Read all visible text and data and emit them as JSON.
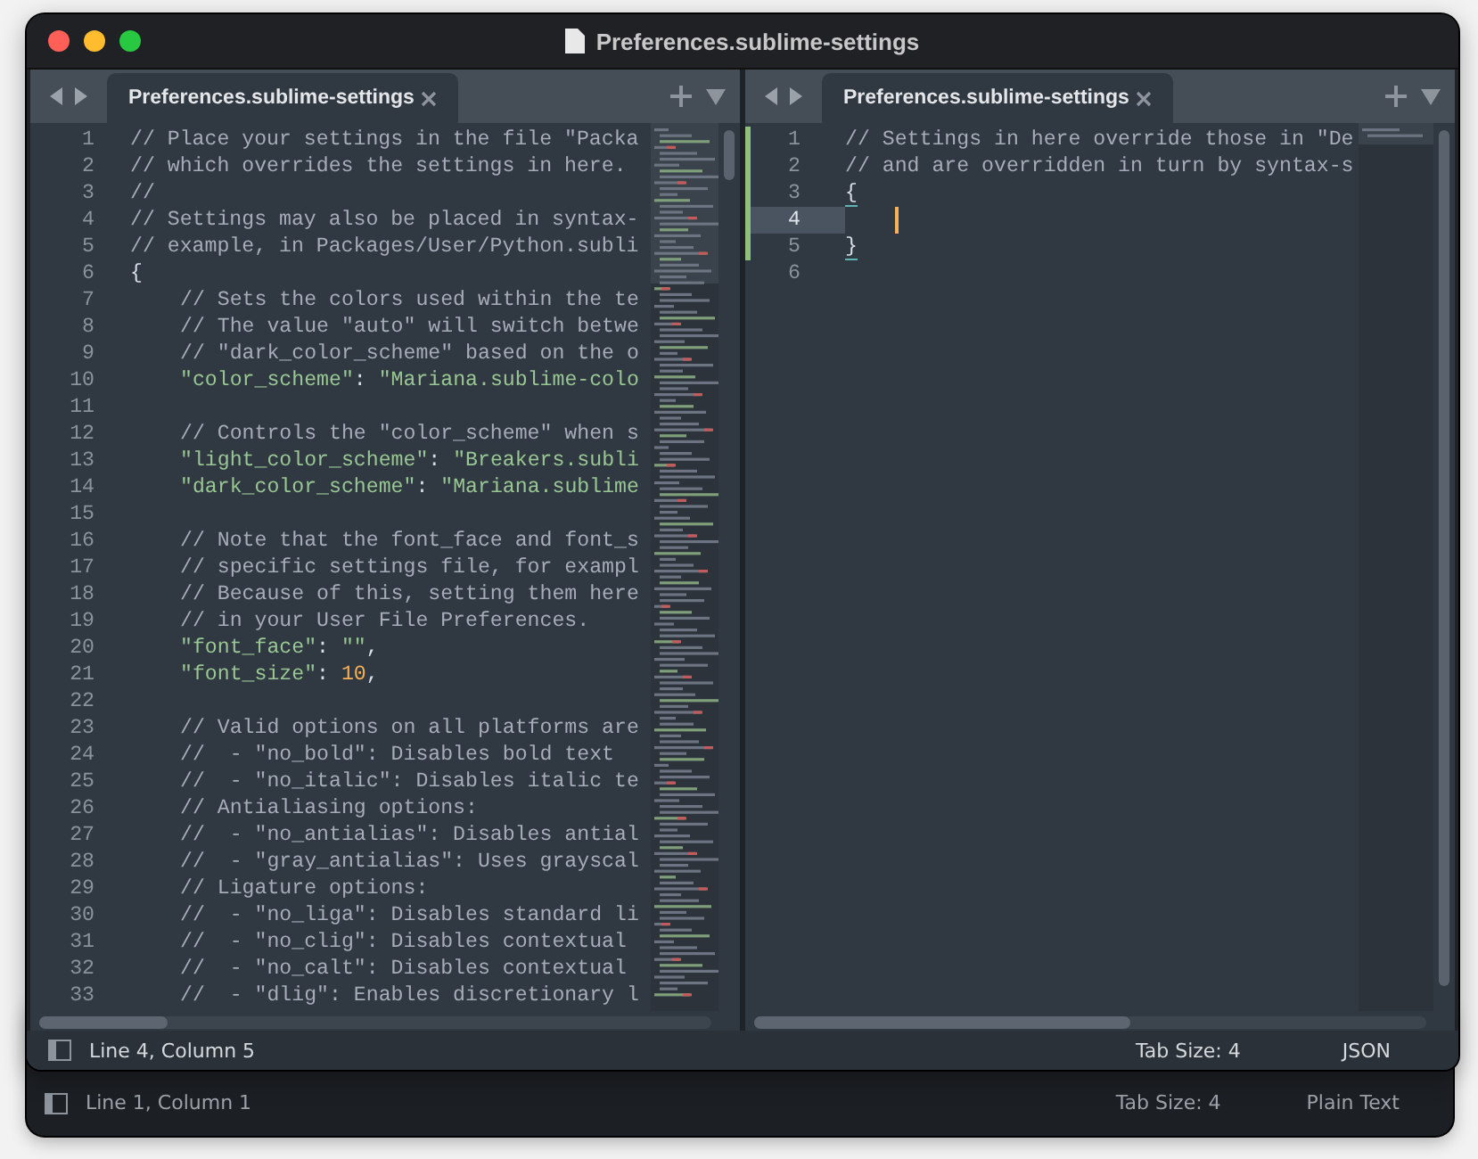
{
  "window": {
    "title": "Preferences.sublime-settings"
  },
  "panes": [
    {
      "tab": {
        "label": "Preferences.sublime-settings",
        "selected": true
      },
      "lines": [
        {
          "n": "1",
          "indented": false,
          "tokens": [
            {
              "kind": "comment",
              "text": "// Place your settings in the file \"Packa"
            }
          ]
        },
        {
          "n": "2",
          "indented": false,
          "tokens": [
            {
              "kind": "comment",
              "text": "// which overrides the settings in here."
            }
          ]
        },
        {
          "n": "3",
          "indented": false,
          "tokens": [
            {
              "kind": "comment",
              "text": "//"
            }
          ]
        },
        {
          "n": "4",
          "indented": false,
          "tokens": [
            {
              "kind": "comment",
              "text": "// Settings may also be placed in syntax-"
            }
          ]
        },
        {
          "n": "5",
          "indented": false,
          "tokens": [
            {
              "kind": "comment",
              "text": "// example, in Packages/User/Python.subli"
            }
          ]
        },
        {
          "n": "6",
          "indented": false,
          "tokens": [
            {
              "kind": "punct",
              "text": "{"
            }
          ]
        },
        {
          "n": "7",
          "indented": true,
          "tokens": [
            {
              "kind": "comment",
              "text": "// Sets the colors used within the te"
            }
          ]
        },
        {
          "n": "8",
          "indented": true,
          "tokens": [
            {
              "kind": "comment",
              "text": "// The value \"auto\" will switch betwe"
            }
          ]
        },
        {
          "n": "9",
          "indented": true,
          "tokens": [
            {
              "kind": "comment",
              "text": "// \"dark_color_scheme\" based on the o"
            }
          ]
        },
        {
          "n": "10",
          "indented": true,
          "tokens": [
            {
              "kind": "key",
              "text": "\"color_scheme\""
            },
            {
              "kind": "punct",
              "text": ": "
            },
            {
              "kind": "string",
              "text": "\"Mariana.sublime-colo"
            }
          ]
        },
        {
          "n": "11"
        },
        {
          "n": "12",
          "indented": true,
          "tokens": [
            {
              "kind": "comment",
              "text": "// Controls the \"color_scheme\" when s"
            }
          ]
        },
        {
          "n": "13",
          "indented": true,
          "tokens": [
            {
              "kind": "key",
              "text": "\"light_color_scheme\""
            },
            {
              "kind": "punct",
              "text": ": "
            },
            {
              "kind": "string",
              "text": "\"Breakers.subli"
            }
          ]
        },
        {
          "n": "14",
          "indented": true,
          "tokens": [
            {
              "kind": "key",
              "text": "\"dark_color_scheme\""
            },
            {
              "kind": "punct",
              "text": ": "
            },
            {
              "kind": "string",
              "text": "\"Mariana.sublime"
            }
          ]
        },
        {
          "n": "15"
        },
        {
          "n": "16",
          "indented": true,
          "tokens": [
            {
              "kind": "comment",
              "text": "// Note that the font_face and font_s"
            }
          ]
        },
        {
          "n": "17",
          "indented": true,
          "tokens": [
            {
              "kind": "comment",
              "text": "// specific settings file, for exampl"
            }
          ]
        },
        {
          "n": "18",
          "indented": true,
          "tokens": [
            {
              "kind": "comment",
              "text": "// Because of this, setting them here"
            }
          ]
        },
        {
          "n": "19",
          "indented": true,
          "tokens": [
            {
              "kind": "comment",
              "text": "// in your User File Preferences."
            }
          ]
        },
        {
          "n": "20",
          "indented": true,
          "tokens": [
            {
              "kind": "key",
              "text": "\"font_face\""
            },
            {
              "kind": "punct",
              "text": ": "
            },
            {
              "kind": "string",
              "text": "\"\""
            },
            {
              "kind": "punct",
              "text": ","
            }
          ]
        },
        {
          "n": "21",
          "indented": true,
          "tokens": [
            {
              "kind": "key",
              "text": "\"font_size\""
            },
            {
              "kind": "punct",
              "text": ": "
            },
            {
              "kind": "number",
              "text": "10"
            },
            {
              "kind": "punct",
              "text": ","
            }
          ]
        },
        {
          "n": "22"
        },
        {
          "n": "23",
          "indented": true,
          "tokens": [
            {
              "kind": "comment",
              "text": "// Valid options on all platforms are"
            }
          ]
        },
        {
          "n": "24",
          "indented": true,
          "tokens": [
            {
              "kind": "comment",
              "text": "//  - \"no_bold\": Disables bold text"
            }
          ]
        },
        {
          "n": "25",
          "indented": true,
          "tokens": [
            {
              "kind": "comment",
              "text": "//  - \"no_italic\": Disables italic te"
            }
          ]
        },
        {
          "n": "26",
          "indented": true,
          "tokens": [
            {
              "kind": "comment",
              "text": "// Antialiasing options:"
            }
          ]
        },
        {
          "n": "27",
          "indented": true,
          "tokens": [
            {
              "kind": "comment",
              "text": "//  - \"no_antialias\": Disables antial"
            }
          ]
        },
        {
          "n": "28",
          "indented": true,
          "tokens": [
            {
              "kind": "comment",
              "text": "//  - \"gray_antialias\": Uses grayscal"
            }
          ]
        },
        {
          "n": "29",
          "indented": true,
          "tokens": [
            {
              "kind": "comment",
              "text": "// Ligature options:"
            }
          ]
        },
        {
          "n": "30",
          "indented": true,
          "tokens": [
            {
              "kind": "comment",
              "text": "//  - \"no_liga\": Disables standard li"
            }
          ]
        },
        {
          "n": "31",
          "indented": true,
          "tokens": [
            {
              "kind": "comment",
              "text": "//  - \"no_clig\": Disables contextual"
            }
          ]
        },
        {
          "n": "32",
          "indented": true,
          "tokens": [
            {
              "kind": "comment",
              "text": "//  - \"no_calt\": Disables contextual"
            }
          ]
        },
        {
          "n": "33",
          "indented": true,
          "tokens": [
            {
              "kind": "comment",
              "text": "//  - \"dlig\": Enables discretionary l"
            }
          ]
        }
      ]
    },
    {
      "tab": {
        "label": "Preferences.sublime-settings",
        "selected": true
      },
      "lines": [
        {
          "n": "1",
          "indented": false,
          "modified": true,
          "current": false,
          "tokens": [
            {
              "kind": "comment",
              "text": "// Settings in here override those in \"De"
            }
          ]
        },
        {
          "n": "2",
          "indented": false,
          "modified": true,
          "current": false,
          "tokens": [
            {
              "kind": "comment",
              "text": "// and are overridden in turn by syntax-s"
            }
          ]
        },
        {
          "n": "3",
          "indented": false,
          "modified": true,
          "current": false,
          "tokens": [
            {
              "kind": "punct",
              "text": "{",
              "matched": true
            }
          ]
        },
        {
          "n": "4",
          "indented": true,
          "modified": true,
          "current": true,
          "caret": true
        },
        {
          "n": "5",
          "indented": false,
          "modified": true,
          "current": false,
          "tokens": [
            {
              "kind": "punct",
              "text": "}",
              "matched": true
            }
          ]
        },
        {
          "n": "6",
          "modified": false,
          "current": false
        }
      ]
    }
  ],
  "status_bar": {
    "position": "Line 4, Column 5",
    "tab_size": "Tab Size: 4",
    "syntax": "JSON"
  },
  "back_window": {
    "status_bar": {
      "position": "Line 1, Column 1",
      "tab_size": "Tab Size: 4",
      "syntax": "Plain Text"
    }
  }
}
